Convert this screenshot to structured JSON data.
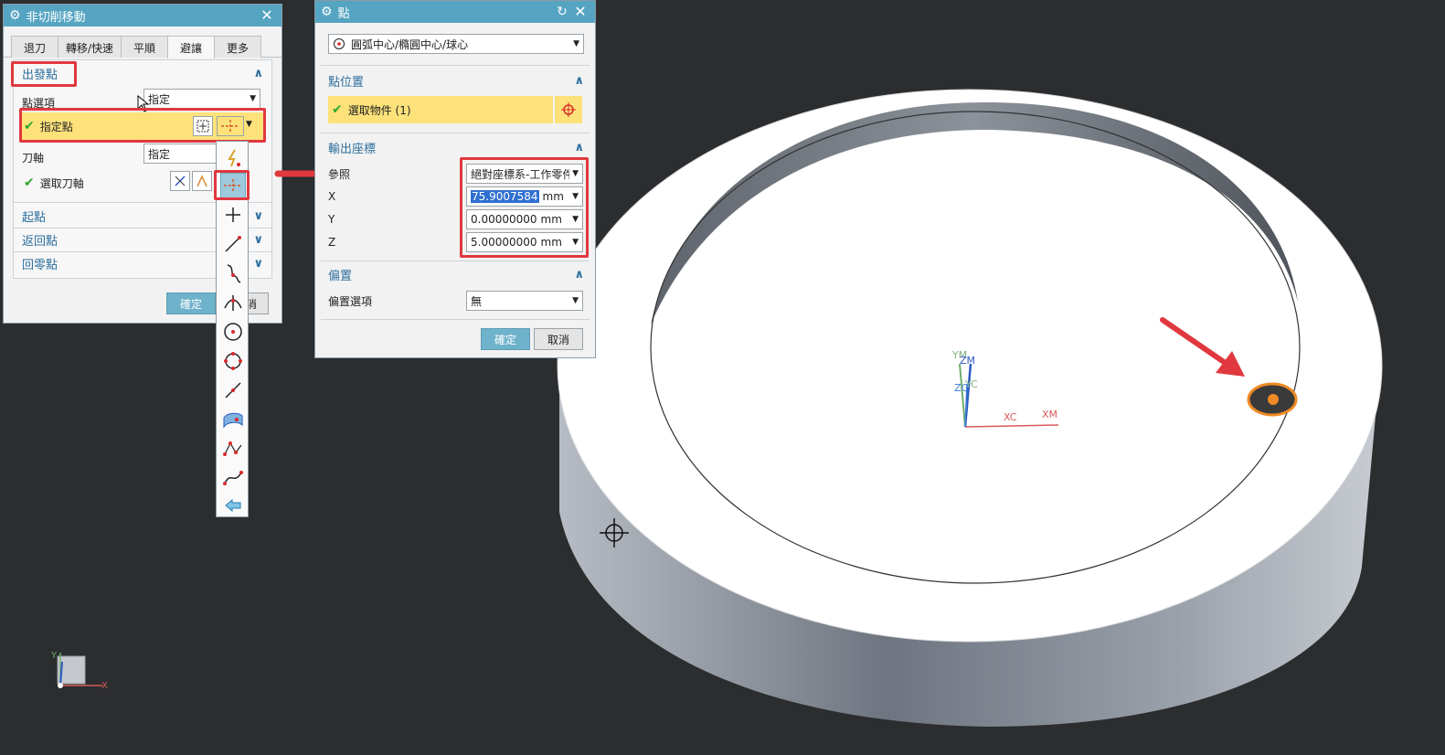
{
  "dialog1": {
    "title": "非切削移動",
    "tabs": [
      "退刀",
      "轉移/快速",
      "平順",
      "避讓",
      "更多"
    ],
    "active_tab": "避讓",
    "section_start_point": "出發點",
    "point_option_label": "點選項",
    "point_option_value": "指定",
    "specify_point_label": "指定點",
    "tool_axis_label": "刀軸",
    "tool_axis_value": "指定",
    "select_tool_axis_label": "選取刀軸",
    "section_start": "起點",
    "section_return": "返回點",
    "section_home": "回零點",
    "ok_label": "確定",
    "cancel_partial": "消"
  },
  "point_dialog": {
    "title": "點",
    "type_value": "圓弧中心/橢圓中心/球心",
    "section_location": "點位置",
    "select_object_label": "選取物件 (1)",
    "section_output": "輸出座標",
    "reference_label": "參照",
    "reference_value": "絕對座標系-工作零件",
    "x_label": "X",
    "x_value": "75.9007584",
    "y_label": "Y",
    "y_value": "0.00000000",
    "z_label": "Z",
    "z_value": "5.00000000",
    "unit": "mm",
    "section_offset": "偏置",
    "offset_option_label": "偏置選項",
    "offset_option_value": "無",
    "ok_label": "確定",
    "cancel_label": "取消"
  },
  "viewport": {
    "axis_labels": [
      "YM",
      "ZM",
      "ZC",
      "YC",
      "XC",
      "XM"
    ],
    "triad_labels": [
      "Y",
      "X"
    ]
  },
  "colors": {
    "titlebar": "#55a4c2",
    "highlight": "#fde27a",
    "annotation_red": "#e0383e",
    "section_blue": "#2e6f9e",
    "background": "#2b2d2f"
  }
}
